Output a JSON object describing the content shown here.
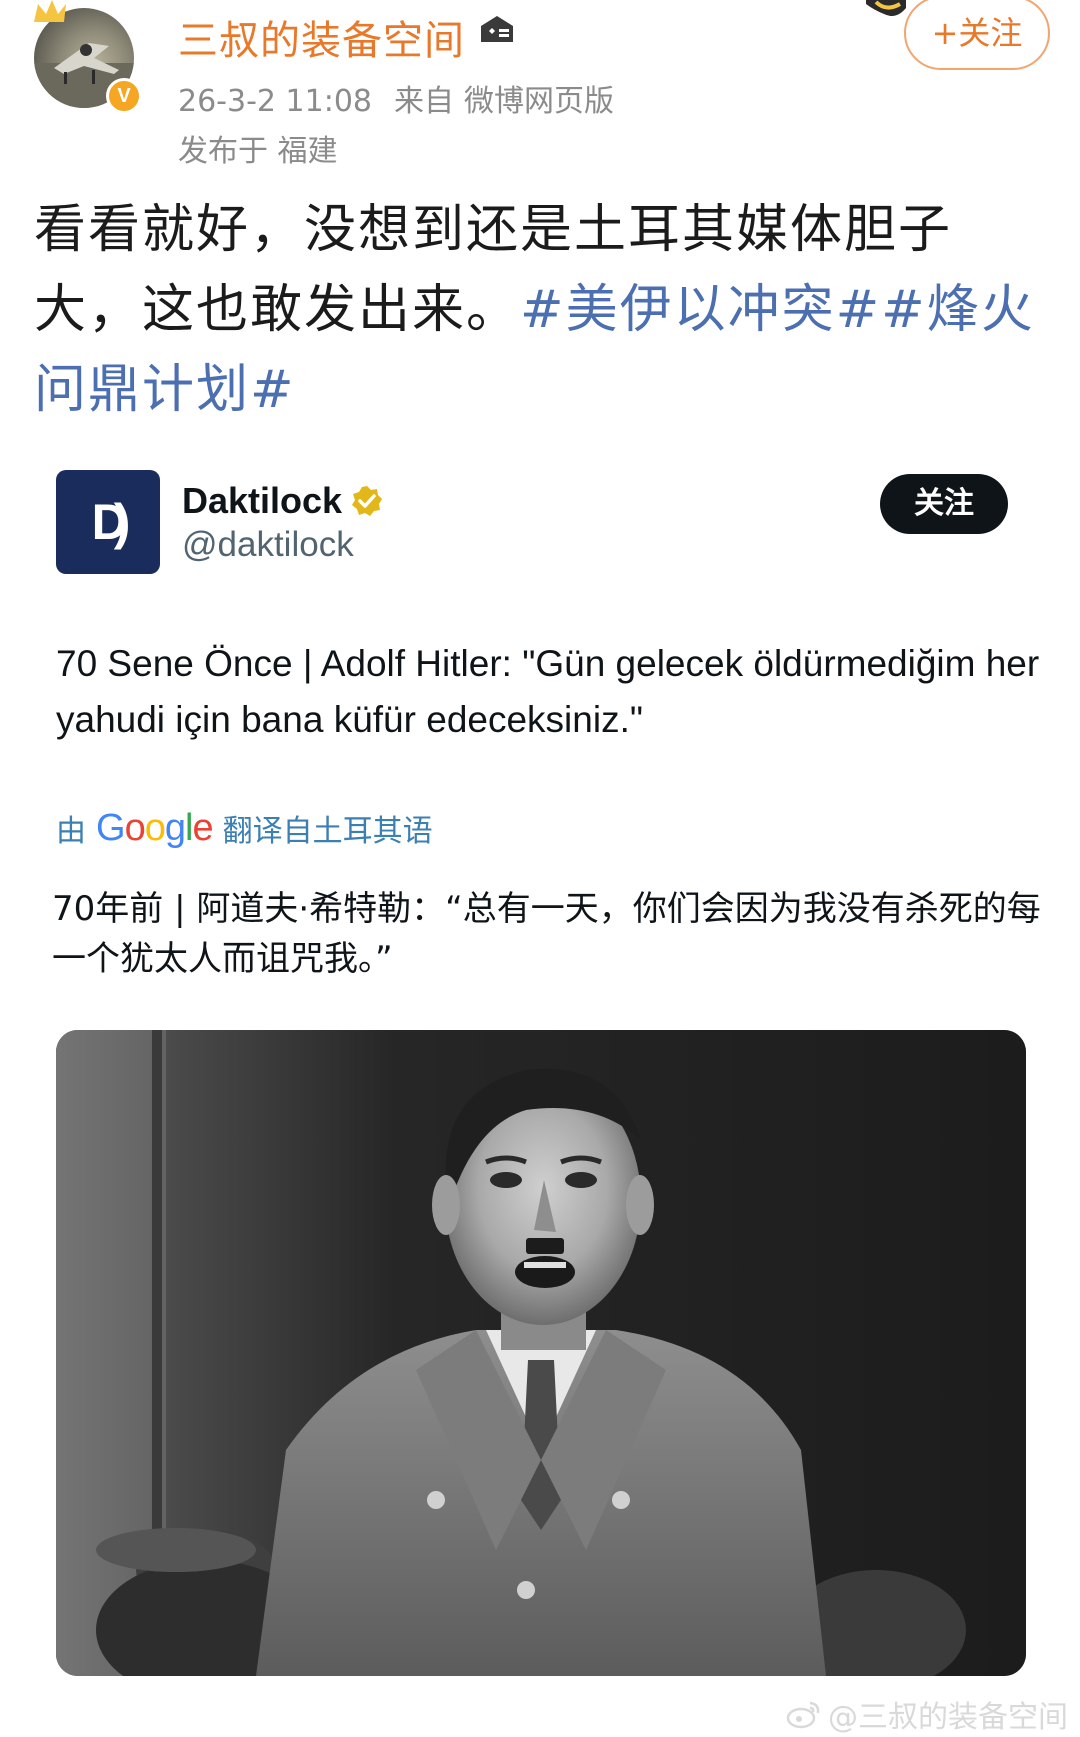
{
  "weibo": {
    "user_name": "三叔的装备空间",
    "verified_badge": "V",
    "follow_label": "+关注",
    "meta": {
      "time": "26-3-2 11:08",
      "source_prefix": "来自",
      "source": "微博网页版",
      "location": "发布于 福建"
    },
    "post": {
      "text": "看看就好，没想到还是土耳其媒体胆子大，这也敢发出来。",
      "hashtags": [
        "#美伊以冲突#",
        "#烽火问鼎计划#"
      ]
    },
    "watermark": "@三叔的装备空间",
    "accent_color": "#e8782a",
    "hashtag_color": "#4b6fb0"
  },
  "tweet": {
    "avatar_letter": "D",
    "name": "Daktilock",
    "handle": "@daktilock",
    "follow_label": "关注",
    "text": "70 Sene Önce | Adolf Hitler: \"Gün gelecek öldürmediğim her yahudi için bana küfür edeceksiniz.\"",
    "translate_prefix": "由",
    "translate_brand": "Google",
    "translate_suffix": "翻译自土耳其语",
    "translated_text": "70年前 | 阿道夫·希特勒：“总有一天，你们会因为我没有杀死的每一个犹太人而诅咒我。”",
    "avatar_color": "#1a2c5b"
  },
  "icons": {
    "level": "level-icon",
    "verified": "verified-check-icon",
    "weibo_logo": "weibo-logo-icon"
  }
}
